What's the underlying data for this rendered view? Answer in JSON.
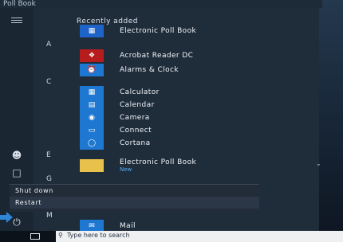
{
  "window": {
    "title": "Poll Book"
  },
  "menu": {
    "section_label": "Recently added",
    "recent": [
      {
        "label": "Electronic Poll Book",
        "icon": "poll-book-icon",
        "color": "#1e64c8"
      }
    ],
    "groups": [
      {
        "letter": "A",
        "apps": [
          {
            "label": "Acrobat Reader DC",
            "icon": "acrobat-icon",
            "color": "#b81d1d"
          },
          {
            "label": "Alarms & Clock",
            "icon": "alarm-clock-icon",
            "color": "#1e78d2"
          }
        ]
      },
      {
        "letter": "C",
        "apps": [
          {
            "label": "Calculator",
            "icon": "calculator-icon",
            "color": "#1e78d2"
          },
          {
            "label": "Calendar",
            "icon": "calendar-icon",
            "color": "#1e78d2"
          },
          {
            "label": "Camera",
            "icon": "camera-icon",
            "color": "#1e78d2"
          },
          {
            "label": "Connect",
            "icon": "connect-icon",
            "color": "#1e78d2"
          },
          {
            "label": "Cortana",
            "icon": "cortana-icon",
            "color": "#1e78d2"
          }
        ]
      },
      {
        "letter": "E",
        "apps": [
          {
            "label": "Electronic Poll Book",
            "sublabel": "New",
            "icon": "folder-icon",
            "color": "#e8c14c"
          }
        ]
      },
      {
        "letter": "G",
        "apps": []
      },
      {
        "letter": "M",
        "apps": [
          {
            "label": "Mail",
            "icon": "mail-icon",
            "color": "#1e78d2"
          }
        ]
      }
    ]
  },
  "power_menu": {
    "items": [
      "Shut down",
      "Restart"
    ]
  },
  "taskbar": {
    "search_placeholder": "Type here to search"
  },
  "colors": {
    "arrow": "#2f86d8",
    "accent": "#4db2ff"
  }
}
